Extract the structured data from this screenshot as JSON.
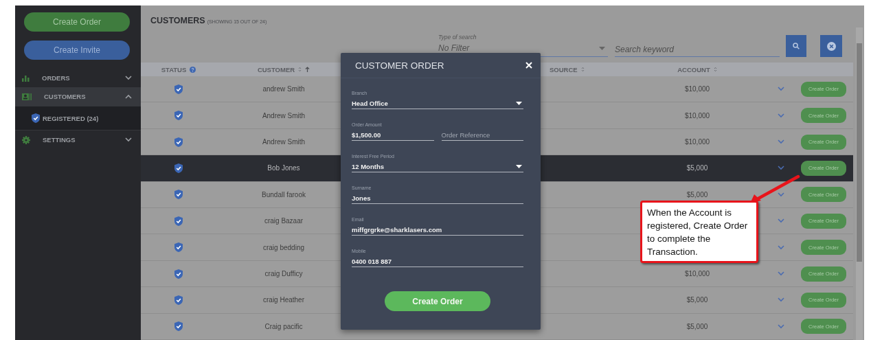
{
  "sidebar": {
    "buttons": [
      {
        "label": "Create Order",
        "kind": "order"
      },
      {
        "label": "Create Invite",
        "kind": "invite"
      }
    ],
    "items": [
      {
        "label": "ORDERS",
        "expanded": false,
        "selected": false
      },
      {
        "label": "CUSTOMERS",
        "expanded": true,
        "selected": true,
        "children": [
          {
            "label": "REGISTERED (24)"
          }
        ]
      },
      {
        "label": "SETTINGS",
        "expanded": false,
        "selected": false
      }
    ]
  },
  "header": {
    "title": "CUSTOMERS",
    "subtitle": "(SHOWING 15 OUT OF 24)"
  },
  "filter": {
    "label": "Type of search",
    "placeholder": "No Filter"
  },
  "search": {
    "placeholder": "Search keyword"
  },
  "table": {
    "columns": [
      {
        "label": "STATUS",
        "kind": "help"
      },
      {
        "label": "CUSTOMER",
        "kind": "sort-asc"
      },
      {
        "label": "SOURCE",
        "kind": "sort"
      },
      {
        "label": "ACCOUNT",
        "kind": "sort"
      }
    ],
    "rows": [
      {
        "customer": "andrew Smith",
        "account": "$10,000",
        "action": "Create Order",
        "selected": false
      },
      {
        "customer": "Andrew Smith",
        "account": "$10,000",
        "action": "Create Order",
        "selected": false
      },
      {
        "customer": "Andrew Smith",
        "account": "$10,000",
        "action": "Create Order",
        "selected": false
      },
      {
        "customer": "Bob Jones",
        "account": "$5,000",
        "action": "Create Order",
        "selected": true
      },
      {
        "customer": "Bundall farook",
        "account": "$5,000",
        "action": "Create Order",
        "selected": false
      },
      {
        "customer": "craig Bazaar",
        "action": "Create Order",
        "selected": false
      },
      {
        "customer": "craig bedding",
        "action": "Create Order",
        "selected": false
      },
      {
        "customer": "craig Dufficy",
        "account": "$10,000",
        "action": "Create Order",
        "selected": false
      },
      {
        "customer": "craig Heather",
        "account": "$5,000",
        "action": "Create Order",
        "selected": false
      },
      {
        "customer": "Craig pacific",
        "account": "$5,000",
        "action": "Create Order",
        "selected": false
      }
    ]
  },
  "modal": {
    "title": "CUSTOMER ORDER",
    "fields": [
      {
        "kind": "select",
        "label": "Branch",
        "value": "Head Office"
      },
      {
        "kind": "pair",
        "items": [
          {
            "label": "Order Amount",
            "value": "$1,500.00"
          },
          {
            "placeholder": "Order Reference"
          }
        ]
      },
      {
        "kind": "select",
        "label": "Interest Free Period",
        "value": "12 Months"
      },
      {
        "kind": "text",
        "label": "Surname",
        "value": "Jones"
      },
      {
        "kind": "text",
        "label": "Email",
        "value": "miffgrgrke@sharklasers.com"
      },
      {
        "kind": "text",
        "label": "Mobile",
        "value": "0400 018 887"
      }
    ],
    "button": "Create Order"
  },
  "callout": {
    "text": "When the Account is registered, Create Order to complete the Transaction."
  }
}
